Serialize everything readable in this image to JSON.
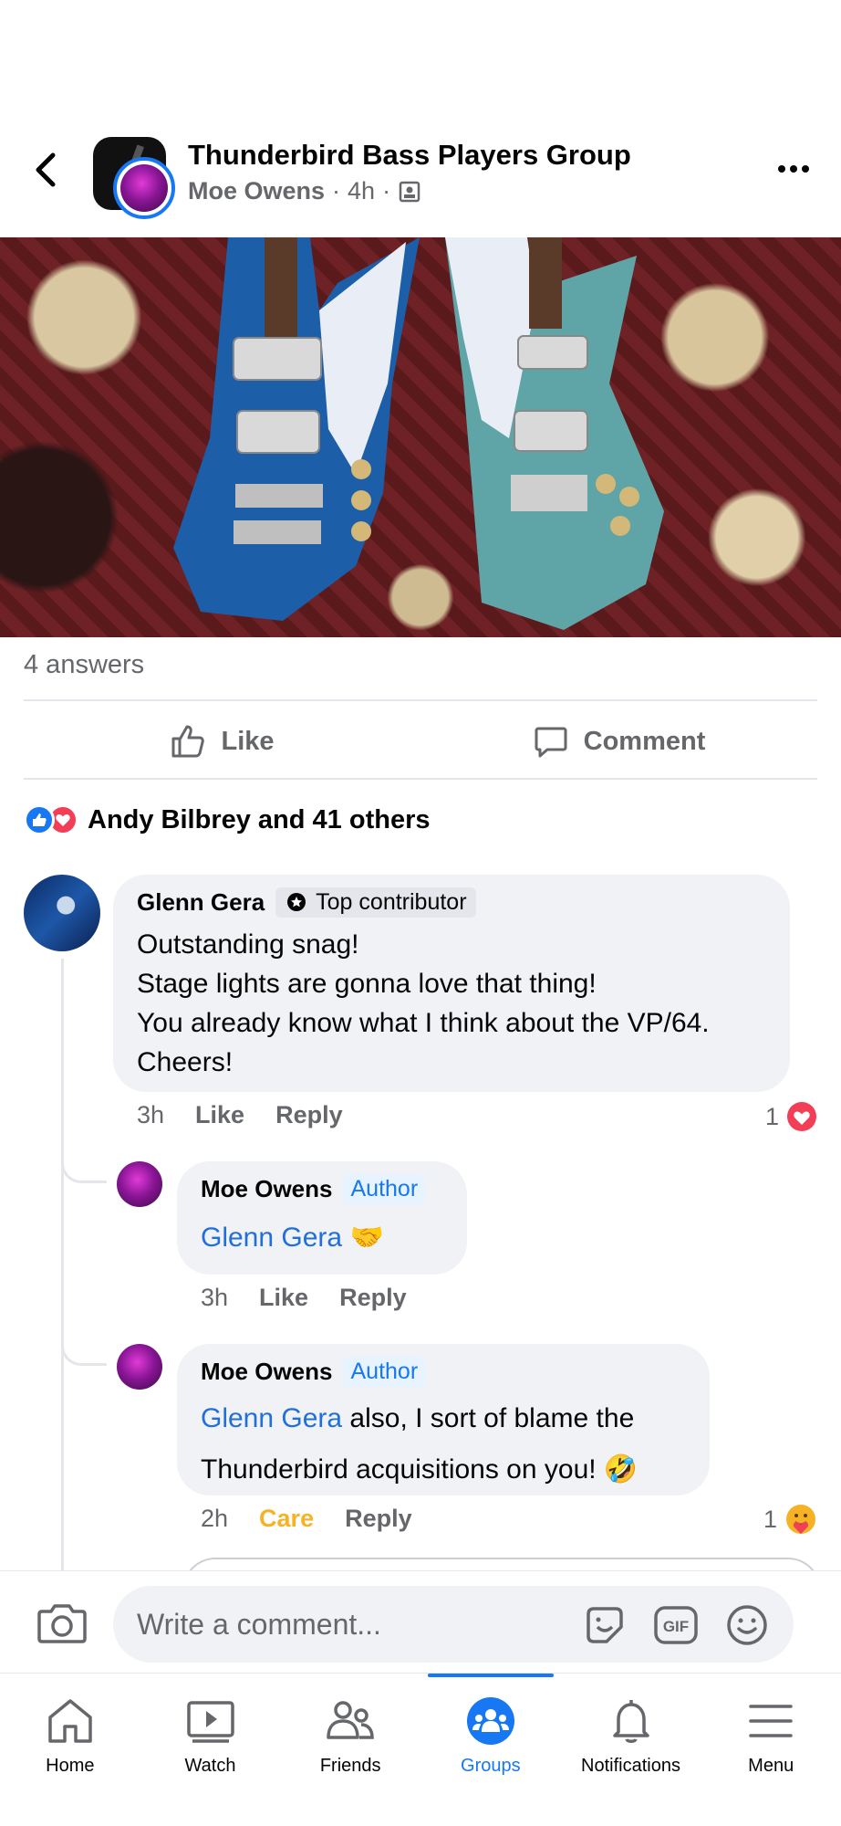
{
  "header": {
    "group_title": "Thunderbird Bass Players Group",
    "post_author": "Moe Owens",
    "separator": "·",
    "post_time": "4h"
  },
  "post": {
    "answers_count": "4 answers",
    "like_label": "Like",
    "comment_label": "Comment",
    "reactions_text": "Andy Bilbrey and 41 others"
  },
  "comments": [
    {
      "author": "Glenn Gera",
      "badge": "Top contributor",
      "lines": [
        "Outstanding snag!",
        "Stage lights are gonna love that thing!",
        "You already know what I think about the VP/64.",
        "Cheers!"
      ],
      "time": "3h",
      "like": "Like",
      "reply": "Reply",
      "reaction_count": "1"
    }
  ],
  "replies": [
    {
      "author": "Moe Owens",
      "badge": "Author",
      "mention": "Glenn Gera",
      "emoji": "🤝",
      "time": "3h",
      "like": "Like",
      "reply": "Reply"
    },
    {
      "author": "Moe Owens",
      "badge": "Author",
      "mention": "Glenn Gera",
      "text_line1": " also, I sort of blame the",
      "text_line2": "Thunderbird acquisitions on you! 🤣",
      "time": "2h",
      "reaction_label": "Care",
      "reply": "Reply",
      "reaction_count": "1"
    }
  ],
  "composer": {
    "placeholder": "Write a comment..."
  },
  "nav": {
    "items": [
      {
        "label": "Home",
        "icon": "home-icon"
      },
      {
        "label": "Watch",
        "icon": "watch-icon"
      },
      {
        "label": "Friends",
        "icon": "friends-icon"
      },
      {
        "label": "Groups",
        "icon": "groups-icon",
        "active": true
      },
      {
        "label": "Notifications",
        "icon": "bell-icon"
      },
      {
        "label": "Menu",
        "icon": "menu-icon"
      }
    ]
  },
  "colors": {
    "accent": "#1877f2",
    "secondary_text": "#65676b",
    "bubble": "#f0f2f5",
    "care": "#f7b125",
    "love": "#f33e58"
  }
}
